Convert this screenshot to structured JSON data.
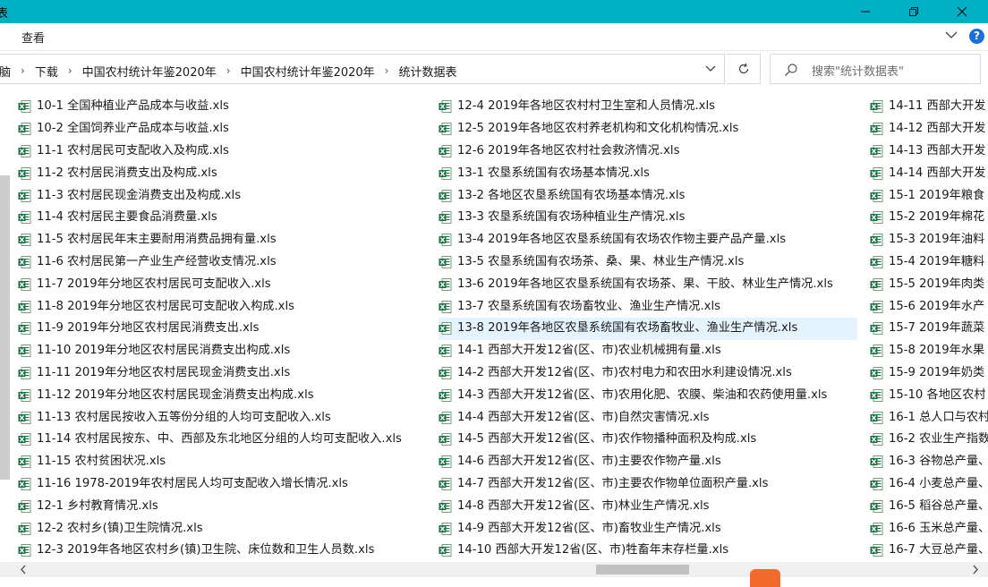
{
  "window": {
    "title_partial": "表",
    "accent_color": "#00b0c5",
    "buttons": {
      "minimize": "minimize-icon",
      "restore": "restore-icon",
      "close": "close-icon"
    }
  },
  "ribbon": {
    "tab_view": "查看",
    "help": "?"
  },
  "address": {
    "crumbs": [
      "电脑",
      "下载",
      "中国农村统计年鉴2020年",
      "中国农村统计年鉴2020年",
      "统计数据表"
    ]
  },
  "search": {
    "placeholder": "搜索\"统计数据表\""
  },
  "files": {
    "col1": [
      "10-1 全国种植业产品成本与收益.xls",
      "10-2 全国饲养业产品成本与收益.xls",
      "11-1 农村居民可支配收入及构成.xls",
      "11-2 农村居民消费支出及构成.xls",
      "11-3 农村居民现金消费支出及构成.xls",
      "11-4 农村居民主要食品消费量.xls",
      "11-5 农村居民年末主要耐用消费品拥有量.xls",
      "11-6 农村居民第一产业生产经营收支情况.xls",
      "11-7 2019年分地区农村居民可支配收入.xls",
      "11-8 2019年分地区农村居民可支配收入构成.xls",
      "11-9 2019年分地区农村居民消费支出.xls",
      "11-10 2019年分地区农村居民消费支出构成.xls",
      "11-11 2019年分地区农村居民现金消费支出.xls",
      "11-12 2019年分地区农村居民现金消费支出构成.xls",
      "11-13 农村居民按收入五等份分组的人均可支配收入.xls",
      "11-14 农村居民按东、中、西部及东北地区分组的人均可支配收入.xls",
      "11-15 农村贫困状况.xls",
      "11-16 1978-2019年农村居民人均可支配收入增长情况.xls",
      "12-1 乡村教育情况.xls",
      "12-2 农村乡(镇)卫生院情况.xls",
      "12-3 2019年各地区农村乡(镇)卫生院、床位数和卫生人员数.xls"
    ],
    "col2": [
      "12-4 2019年各地区农村村卫生室和人员情况.xls",
      "12-5 2019年各地区农村养老机构和文化机构情况.xls",
      "12-6 2019年各地区农村社会救济情况.xls",
      "13-1 农垦系统国有农场基本情况.xls",
      "13-2 各地区农垦系统国有农场基本情况.xls",
      "13-3 农垦系统国有农场种植业生产情况.xls",
      "13-4 2019年各地区农垦系统国有农场农作物主要产品产量.xls",
      "13-5 农垦系统国有农场茶、桑、果、林业生产情况.xls",
      "13-6 2019年各地区农垦系统国有农场茶、果、干胶、林业生产情况.xls",
      "13-7 农垦系统国有农场畜牧业、渔业生产情况.xls",
      "13-8 2019年各地区农垦系统国有农场畜牧业、渔业生产情况.xls",
      "14-1 西部大开发12省(区、市)农业机械拥有量.xls",
      "14-2 西部大开发12省(区、市)农村电力和农田水利建设情况.xls",
      "14-3 西部大开发12省(区、市)农用化肥、农膜、柴油和农药使用量.xls",
      "14-4 西部大开发12省(区、市)自然灾害情况.xls",
      "14-5 西部大开发12省(区、市)农作物播种面积及构成.xls",
      "14-6 西部大开发12省(区、市)主要农作物产量.xls",
      "14-7 西部大开发12省(区、市)主要农作物单位面积产量.xls",
      "14-8 西部大开发12省(区、市)林业生产情况.xls",
      "14-9 西部大开发12省(区、市)畜牧业生产情况.xls",
      "14-10 西部大开发12省(区、市)牲畜年末存栏量.xls"
    ],
    "col3": [
      "14-11 西部大开发",
      "14-12 西部大开发",
      "14-13 西部大开发",
      "14-14 西部大开发",
      "15-1 2019年粮食",
      "15-2 2019年棉花",
      "15-3 2019年油料",
      "15-4 2019年糖料",
      "15-5 2019年肉类",
      "15-6 2019年水产",
      "15-7 2019年蔬菜",
      "15-8 2019年水果",
      "15-9 2019年奶类",
      "15-10 各地区农村",
      "16-1 总人口与农村",
      "16-2 农业生产指数",
      "16-3 谷物总产量、",
      "16-4 小麦总产量、",
      "16-5 稻谷总产量、",
      "16-6 玉米总产量、",
      "16-7 大豆总产量、"
    ],
    "selected": "13-8 2019年各地区农垦系统国有农场畜牧业、渔业生产情况.xls",
    "icon": "excel-file-icon"
  }
}
